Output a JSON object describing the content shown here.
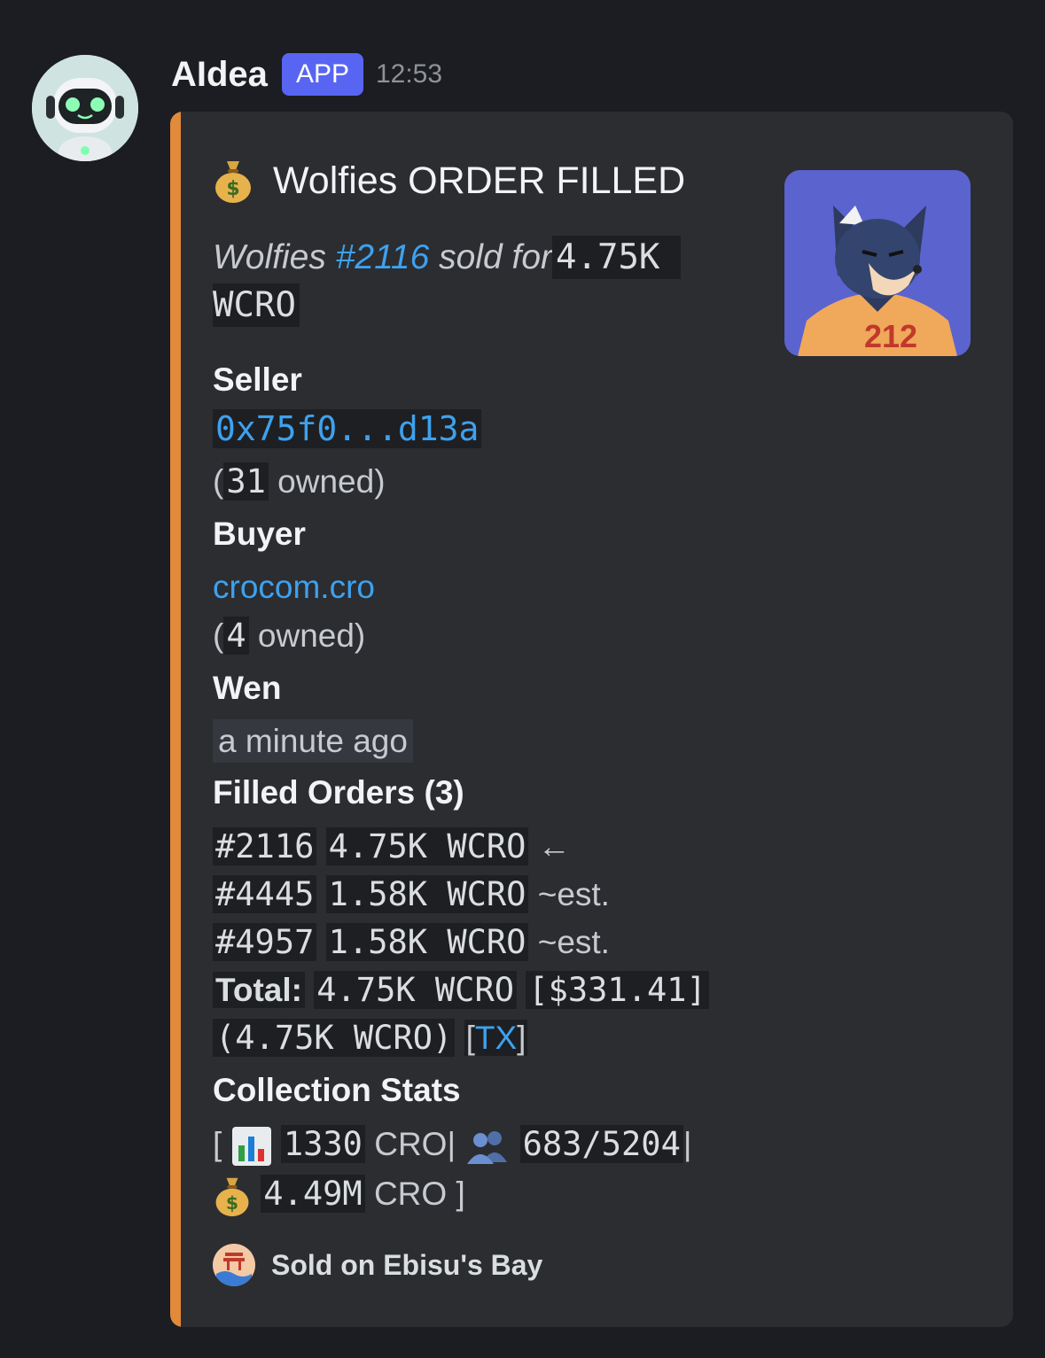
{
  "message": {
    "username": "AIdea",
    "badge": "APP",
    "time": "12:53"
  },
  "embed": {
    "accent_color": "#e08a3a",
    "title_icon": "money-bag-icon",
    "title": "Wolfies ORDER FILLED",
    "subtitle": {
      "prefix": "Wolfies",
      "token_link": "#2116",
      "middle": "sold for",
      "price_line1": "4.75K",
      "price_line2": "WCRO"
    },
    "thumbnail": {
      "jersey_number": "212",
      "bg_color": "#5b63cf"
    },
    "seller": {
      "label": "Seller",
      "address": "0x75f0...d13a",
      "owned_open": "(",
      "owned_count": "31",
      "owned_close": "owned)"
    },
    "buyer": {
      "label": "Buyer",
      "address": "crocom.cro",
      "owned_open": "(",
      "owned_count": "4",
      "owned_close": "owned)"
    },
    "wen": {
      "label": "Wen",
      "value": "a minute ago"
    },
    "filled_orders": {
      "label": "Filled Orders (3)",
      "rows": [
        {
          "id": "#2116",
          "price": "4.75K WCRO",
          "note": "←"
        },
        {
          "id": "#4445",
          "price": "1.58K WCRO",
          "note": "~est."
        },
        {
          "id": "#4957",
          "price": "1.58K WCRO",
          "note": "~est."
        }
      ],
      "total_label": "Total:",
      "total_value": "4.75K WCRO",
      "total_usd": "[$331.41]",
      "total_native": "(4.75K WCRO)",
      "tx_open": "[",
      "tx_link": "TX",
      "tx_close": "]"
    },
    "collection_stats": {
      "label": "Collection Stats",
      "open_bracket": "[",
      "floor": "1330",
      "floor_unit": "CRO",
      "sep": "|",
      "holders": "683/5204",
      "volume": "4.49M",
      "volume_unit": "CRO",
      "close_bracket": "]",
      "icons": [
        "bar-chart-icon",
        "users-icon",
        "money-bag-icon"
      ]
    },
    "footer": {
      "icon": "ebisus-bay-icon",
      "text": "Sold on Ebisu's Bay"
    }
  }
}
